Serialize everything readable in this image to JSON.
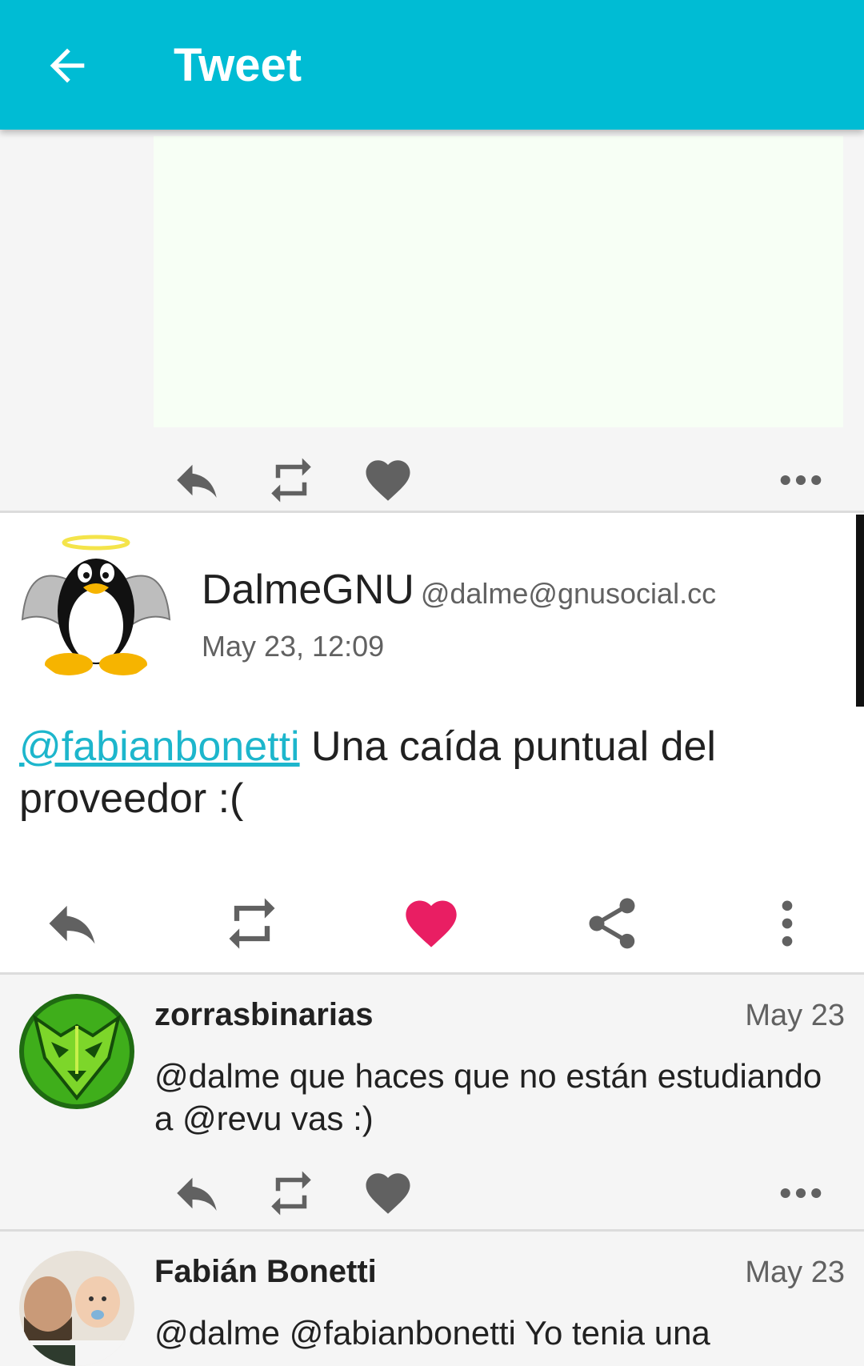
{
  "appbar": {
    "title": "Tweet"
  },
  "icons": {
    "back": "arrow-left-icon",
    "reply": "reply-icon",
    "retweet": "retweet-icon",
    "favorite": "heart-icon",
    "share": "share-icon",
    "more_horizontal": "more-horizontal-icon",
    "more_vertical": "more-vertical-icon"
  },
  "colors": {
    "appbar": "#00bcd4",
    "mention": "#1db6cc",
    "favorite_active": "#e91e63",
    "icon": "#616161"
  },
  "main_tweet": {
    "display_name": "DalmeGNU",
    "handle": "@dalme@gnusocial.cc",
    "date": "May 23, 12:09",
    "mention": "@fabianbonetti",
    "text": " Una caída puntual del proveedor :(",
    "favorited": true
  },
  "replies": [
    {
      "name": "zorrasbinarias",
      "date": "May 23",
      "text": "@dalme que haces que no están estudiando a @revu vas :)"
    },
    {
      "name": "Fabián Bonetti",
      "date": "May 23",
      "text": "@dalme @fabianbonetti Yo tenia una"
    }
  ]
}
